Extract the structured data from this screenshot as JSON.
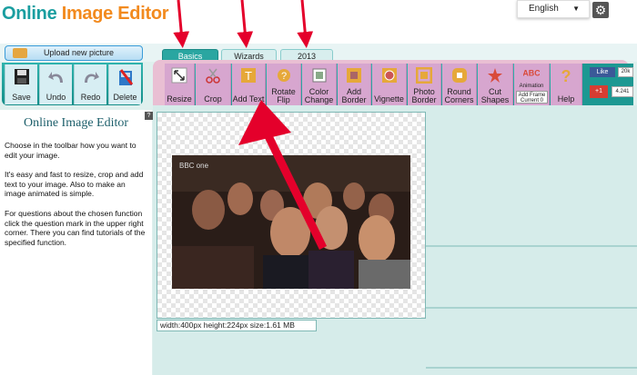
{
  "header": {
    "logo_part1": "Online ",
    "logo_part2": "Image Editor",
    "language": "English"
  },
  "upload_label": "Upload new picture",
  "tabs": [
    {
      "label": "Basics",
      "active": true
    },
    {
      "label": "Wizards",
      "active": false
    },
    {
      "label": "2013",
      "active": false
    }
  ],
  "left_toolbar": [
    {
      "label": "Save",
      "icon": "save-icon"
    },
    {
      "label": "Undo",
      "icon": "undo-icon"
    },
    {
      "label": "Redo",
      "icon": "redo-icon"
    },
    {
      "label": "Delete",
      "icon": "delete-icon"
    }
  ],
  "tools": [
    {
      "label": "Resize",
      "icon": "resize-icon"
    },
    {
      "label": "Crop",
      "icon": "scissors-icon"
    },
    {
      "label": "Add Text",
      "icon": "text-icon"
    },
    {
      "label1": "Rotate",
      "label2": "Flip",
      "icon": "rotate-icon"
    },
    {
      "label1": "Color",
      "label2": "Change",
      "icon": "color-icon"
    },
    {
      "label1": "Add",
      "label2": "Border",
      "icon": "border-icon"
    },
    {
      "label": "Vignette",
      "icon": "vignette-icon"
    },
    {
      "label1": "Photo",
      "label2": "Border",
      "icon": "photo-border-icon"
    },
    {
      "label1": "Round",
      "label2": "Corners",
      "icon": "round-corners-icon"
    },
    {
      "label1": "Cut",
      "label2": "Shapes",
      "icon": "shapes-icon"
    },
    {
      "label": "Help",
      "icon": "help-icon"
    }
  ],
  "add_frame": {
    "animation": "Animation",
    "line1": "Add Frame",
    "line2": "Current 0"
  },
  "social": {
    "fb_like": "Like",
    "fb_count": "20k",
    "gplus": "+1",
    "gplus_count": "4.241"
  },
  "panel": {
    "title": "Online Image Editor",
    "p1": "Choose in the toolbar how you want to edit your image.",
    "p2": "It's easy and fast to resize, crop and add text to your image. Also to make an image animated is simple.",
    "p3": "For questions about the chosen function click the question mark in the upper right corner. There you can find tutorials of the specified function."
  },
  "image_info": "width:400px  height:224px  size:1.61 MB",
  "photo_watermark": "BBC one"
}
